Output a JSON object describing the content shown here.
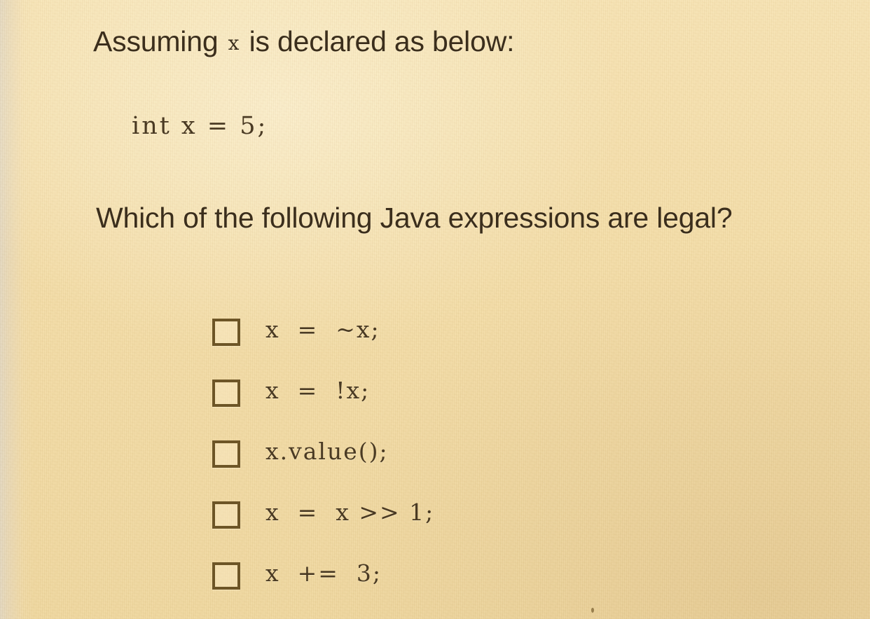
{
  "document": {
    "paper_color": "#f2dba5",
    "ink_color": "#4a3a23",
    "checkbox_border_color": "#6d5526"
  },
  "question": {
    "prompt_prefix": "Assuming",
    "prompt_variable": "x",
    "prompt_suffix": "is declared as below:",
    "code_declaration": "int x = 5;",
    "question_text": "Which of the following Java expressions are legal?"
  },
  "options": [
    {
      "id": "option-a",
      "label": "x  =  ~x;",
      "checked": false
    },
    {
      "id": "option-b",
      "label": "x  =  !x;",
      "checked": false
    },
    {
      "id": "option-c",
      "label": "x.value();",
      "checked": false
    },
    {
      "id": "option-d",
      "label": "x  =  x >> 1;",
      "checked": false
    },
    {
      "id": "option-e",
      "label": "x  +=  3;",
      "checked": false
    }
  ]
}
